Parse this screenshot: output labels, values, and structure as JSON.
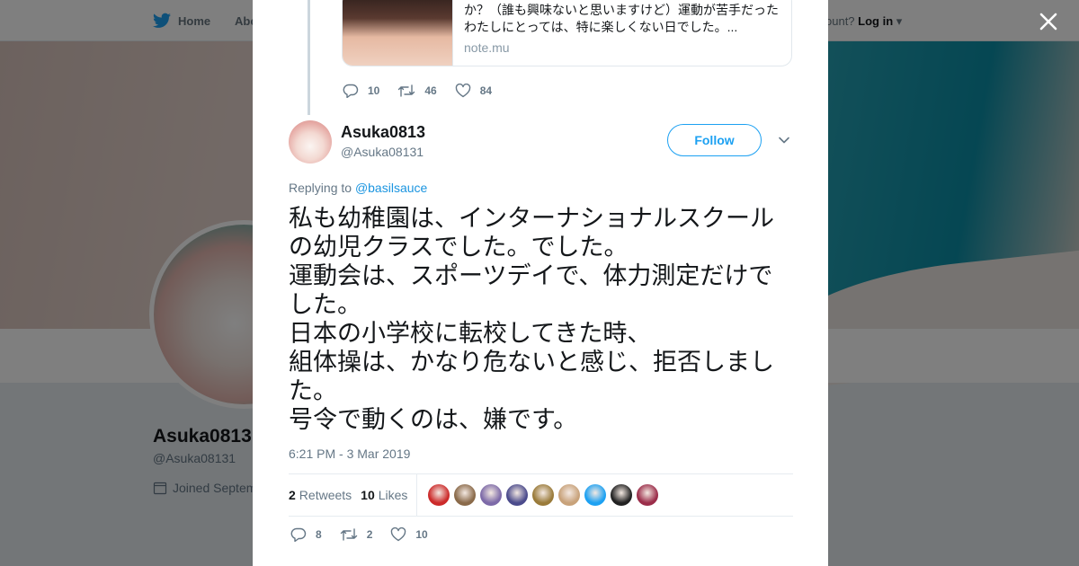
{
  "background": {
    "nav": {
      "home_label": "Home",
      "about_label": "Abo",
      "login_prefix": "ccount?",
      "login_label": "Log in"
    },
    "profile": {
      "name": "Asuka0813",
      "handle": "@Asuka08131",
      "joined": "Joined Septem"
    }
  },
  "quoted_card": {
    "description": "か？（誰も興味ないと思いますけど）運動が苦手だったわたしにとっては、特に楽しくない日でした。...",
    "domain": "note.mu"
  },
  "parent_actions": {
    "replies": "10",
    "retweets": "46",
    "likes": "84"
  },
  "tweet": {
    "display_name": "Asuka0813",
    "handle": "@Asuka08131",
    "follow_label": "Follow",
    "replying_prefix": "Replying to",
    "replying_to": "@basilsauce",
    "text_lines": [
      "私も幼稚園は、インターナショナルスクールの幼児クラスでした。でした。",
      "運動会は、スポーツデイで、体力測定だけでした。",
      "日本の小学校に転校してきた時、",
      "組体操は、かなり危ないと感じ、拒否しました。",
      "号令で動くのは、嫌です。"
    ],
    "timestamp": "6:21 PM - 3 Mar 2019",
    "retweets_count": "2",
    "retweets_label": "Retweets",
    "likes_count": "10",
    "likes_label": "Likes",
    "actions": {
      "replies": "8",
      "retweets": "2",
      "likes": "10"
    }
  },
  "liker_colors": [
    "#cc2a2a",
    "#8a6a4a",
    "#7d6aa8",
    "#4b4b8c",
    "#9a7b3a",
    "#c8a27a",
    "#1da1f2",
    "#222222",
    "#9b2d4a"
  ],
  "colors": {
    "accent": "#1da1f2",
    "text": "#14171a",
    "muted": "#657786"
  }
}
